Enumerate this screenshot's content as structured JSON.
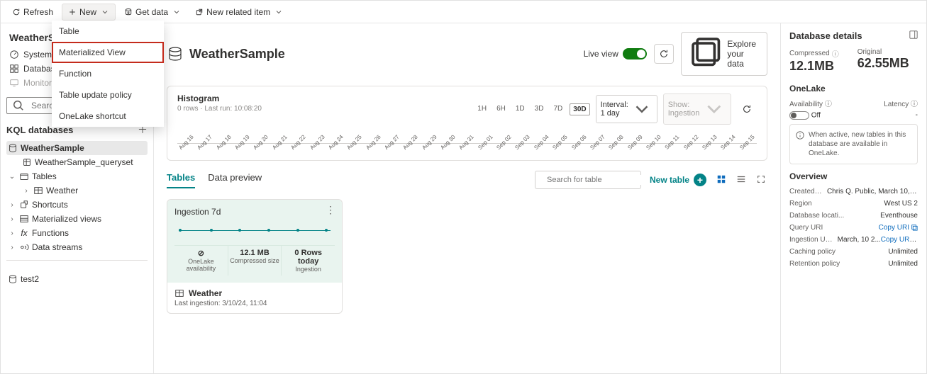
{
  "toolbar": {
    "refresh": "Refresh",
    "new": "New",
    "get_data": "Get data",
    "new_related": "New related item"
  },
  "new_menu": {
    "items": [
      "Table",
      "Materialized View",
      "Function",
      "Table update policy",
      "OneLake shortcut"
    ],
    "highlighted_index": 1
  },
  "sidebar": {
    "title": "WeatherSample",
    "nav": {
      "system_overview": "System overview",
      "databases": "Databases",
      "monitoring": "Monitoring"
    },
    "search_placeholder": "Search",
    "section_heading": "KQL databases",
    "tree": {
      "db_name": "WeatherSample",
      "queryset": "WeatherSample_queryset",
      "tables_label": "Tables",
      "weather_table": "Weather",
      "shortcuts": "Shortcuts",
      "mat_views": "Materialized views",
      "functions": "Functions",
      "data_streams": "Data streams"
    },
    "other_db": "test2"
  },
  "main": {
    "db_title": "WeatherSample",
    "live_view_label": "Live view",
    "explore_btn": "Explore your data",
    "histogram": {
      "title": "Histogram",
      "sub": "0 rows · Last run: 10:08:20",
      "ranges": [
        "1H",
        "6H",
        "1D",
        "3D",
        "7D",
        "30D"
      ],
      "active_range_index": 5,
      "interval_label": "Interval: 1 day",
      "show_label": "Show: Ingestion"
    },
    "tabs": {
      "tables": "Tables",
      "preview": "Data preview",
      "active_tab": 0
    },
    "tables_area": {
      "search_placeholder": "Search for table",
      "new_table_label": "New table"
    },
    "card": {
      "title": "Ingestion 7d",
      "stat1_value": "⊘",
      "stat1_label": "OneLake availability",
      "stat2_value": "12.1 MB",
      "stat2_label": "Compressed size",
      "stat3_value": "0 Rows today",
      "stat3_label": "Ingestion",
      "name": "Weather",
      "last_ing": "Last ingestion: 3/10/24, 11:04"
    }
  },
  "details": {
    "panel_title": "Database details",
    "compressed_label": "Compressed",
    "compressed_value": "12.1MB",
    "original_label": "Original",
    "original_value": "62.55MB",
    "onelake": {
      "heading": "OneLake",
      "availability_label": "Availability",
      "latency_label": "Latency",
      "off_label": "Off",
      "latency_value": "-",
      "banner": "When active, new tables in this database are available in OneLake."
    },
    "overview": {
      "heading": "Overview",
      "created_by_k": "Created by",
      "created_by_v": "Chris Q. Public, March 10, 1...",
      "region_k": "Region",
      "region_v": "West US 2",
      "location_k": "Database locati...",
      "location_v": "Eventhouse",
      "query_uri_k": "Query URI",
      "query_uri_v": "Copy URI",
      "ingestion_url_k": "Ingestion URL",
      "ingestion_url_v": "March, 10 2...",
      "ingestion_copy": "Copy URI",
      "caching_k": "Caching policy",
      "caching_v": "Unlimited",
      "retention_k": "Retention policy",
      "retention_v": "Unlimited"
    }
  },
  "chart_data": {
    "type": "bar",
    "categories": [
      "Aug 16",
      "Aug 17",
      "Aug 18",
      "Aug 19",
      "Aug 20",
      "Aug 21",
      "Aug 22",
      "Aug 23",
      "Aug 24",
      "Aug 25",
      "Aug 26",
      "Aug 27",
      "Aug 28",
      "Aug 29",
      "Aug 30",
      "Aug 31",
      "Sep 01",
      "Sep 02",
      "Sep 03",
      "Sep 04",
      "Sep 05",
      "Sep 06",
      "Sep 07",
      "Sep 08",
      "Sep 09",
      "Sep 10",
      "Sep 11",
      "Sep 12",
      "Sep 13",
      "Sep 14",
      "Sep 15"
    ],
    "values": [
      0,
      0,
      0,
      0,
      0,
      0,
      0,
      0,
      0,
      0,
      0,
      0,
      0,
      0,
      0,
      0,
      0,
      0,
      0,
      0,
      0,
      0,
      0,
      0,
      0,
      0,
      0,
      0,
      0,
      0,
      0
    ],
    "title": "Histogram",
    "xlabel": "",
    "ylabel": "",
    "ylim": [
      0,
      1
    ]
  }
}
